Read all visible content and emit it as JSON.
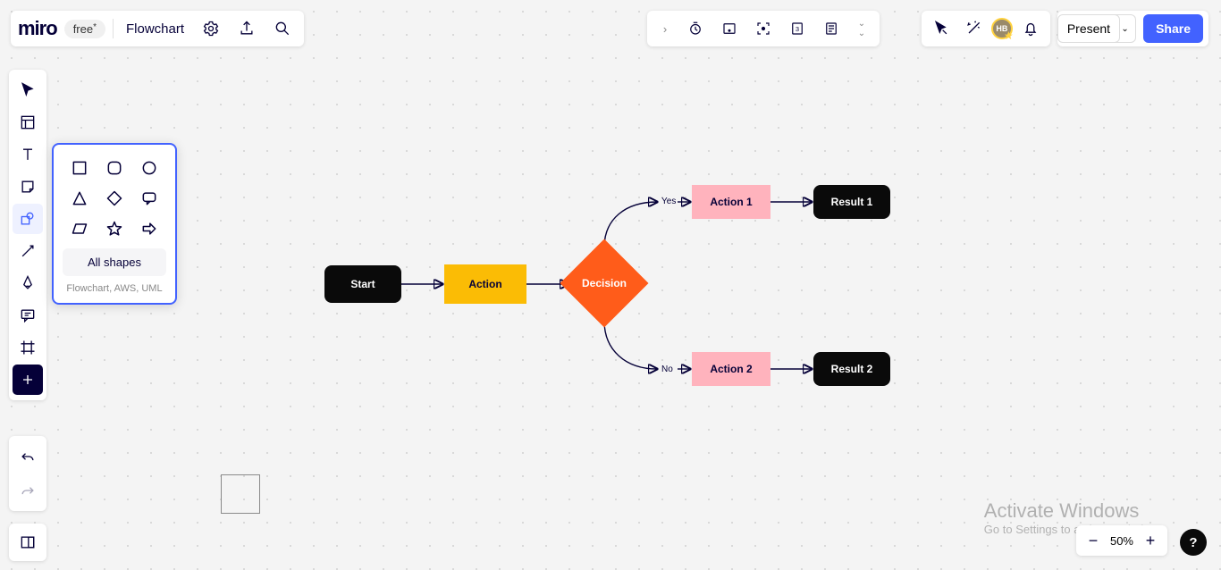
{
  "header": {
    "logo": "miro",
    "plan": "free",
    "doc_title": "Flowchart",
    "present_label": "Present",
    "share_label": "Share",
    "avatar_initials": "HB"
  },
  "shapes_panel": {
    "grid": [
      [
        "square",
        "rounded-square",
        "circle"
      ],
      [
        "triangle",
        "diamond",
        "speech-bubble"
      ],
      [
        "parallelogram",
        "star",
        "arrow-right"
      ]
    ],
    "all_shapes": "All shapes",
    "hint": "Flowchart, AWS, UML"
  },
  "flow": {
    "start": "Start",
    "action": "Action",
    "decision": "Decision",
    "action1": "Action 1",
    "action2": "Action 2",
    "result1": "Result 1",
    "result2": "Result 2",
    "yes": "Yes",
    "no": "No"
  },
  "zoom": {
    "value": "50%"
  },
  "watermark": {
    "line1": "Activate Windows",
    "line2": "Go to Settings to activate Windows."
  },
  "help": "?"
}
